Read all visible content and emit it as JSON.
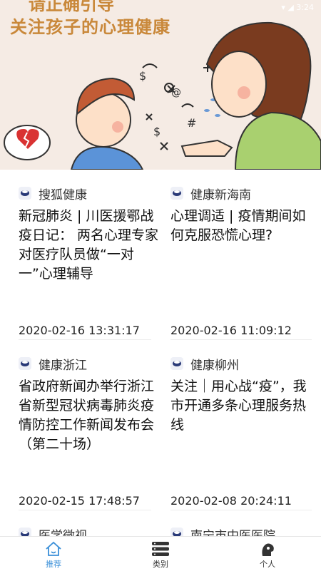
{
  "hero": {
    "title_top": "请正确引导",
    "title": "关注孩子的心理健康",
    "status": "▾ ◢ 3:24"
  },
  "cards": [
    {
      "source": "搜狐健康",
      "title": "新冠肺炎 | 川医援鄂战疫日记： 两名心理专家对医疗队员做“一对一”心理辅导",
      "time": "2020-02-16 13:31:17"
    },
    {
      "source": "健康新海南",
      "title": "心理调适 | 疫情期间如何克服恐慌心理?",
      "time": "2020-02-16 11:09:12"
    },
    {
      "source": "健康浙江",
      "title": "省政府新闻办举行浙江省新型冠状病毒肺炎疫情防控工作新闻发布会（第二十场）",
      "time": "2020-02-15 17:48:57"
    },
    {
      "source": "健康柳州",
      "title": "关注｜用心战“疫”，我市开通多条心理服务热线",
      "time": "2020-02-08 20:24:11"
    },
    {
      "source": "医学微视",
      "title": "",
      "time": ""
    },
    {
      "source": "南宁市中医医院",
      "title": "",
      "time": ""
    }
  ],
  "nav": [
    {
      "label": "推荐",
      "icon": "home-icon",
      "active": true
    },
    {
      "label": "类别",
      "icon": "category-icon",
      "active": false
    },
    {
      "label": "个人",
      "icon": "person-icon",
      "active": false
    }
  ],
  "colors": {
    "accent": "#3a8fd8",
    "hero_title": "#c9883a"
  }
}
